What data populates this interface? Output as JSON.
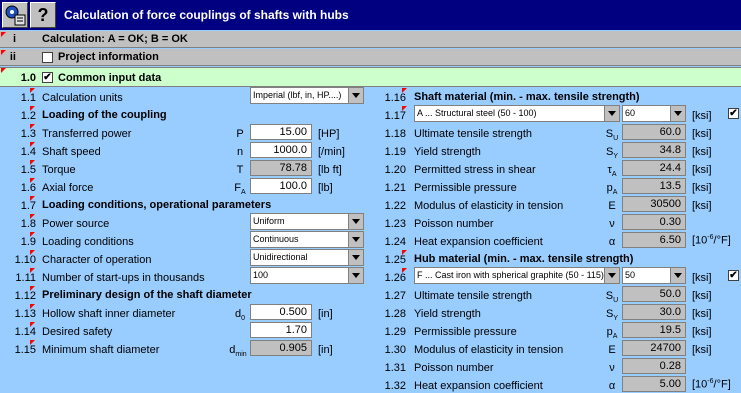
{
  "title": "Calculation of force couplings of shafts with hubs",
  "icons": {
    "app": "gear-calculator-icon",
    "help": "help-icon"
  },
  "help_label": "?",
  "band_i": {
    "num": "i",
    "text": "Calculation:  A = OK;  B = OK"
  },
  "band_ii": {
    "num": "ii",
    "text": "Project information",
    "checked": false
  },
  "band_1": {
    "num": "1.0",
    "text": "Common input data",
    "checked": true,
    "check_mark": "✔"
  },
  "left": {
    "r1_1": {
      "num": "1.1",
      "label": "Calculation units",
      "select": "Imperial (lbf, in, HP....)"
    },
    "r1_2": {
      "num": "1.2",
      "label": "Loading of the coupling"
    },
    "r1_3": {
      "num": "1.3",
      "label": "Transferred power",
      "sym": "P",
      "value": "15.00",
      "unit": "[HP]"
    },
    "r1_4": {
      "num": "1.4",
      "label": "Shaft speed",
      "sym": "n",
      "value": "1000.0",
      "unit": "[/min]"
    },
    "r1_5": {
      "num": "1.5",
      "label": "Torque",
      "sym": "T",
      "value": "78.78",
      "unit": "[lb ft]"
    },
    "r1_6": {
      "num": "1.6",
      "label": "Axial force",
      "sym": "F",
      "sym_sub": "A",
      "value": "100.0",
      "unit": "[lb]"
    },
    "r1_7": {
      "num": "1.7",
      "label": "Loading conditions, operational parameters"
    },
    "r1_8": {
      "num": "1.8",
      "label": "Power source",
      "select": "Uniform"
    },
    "r1_9": {
      "num": "1.9",
      "label": "Loading conditions",
      "select": "Continuous"
    },
    "r1_10": {
      "num": "1.10",
      "label": "Character of operation",
      "select": "Unidirectional"
    },
    "r1_11": {
      "num": "1.11",
      "label": "Number of start-ups in thousands",
      "select": "100"
    },
    "r1_12": {
      "num": "1.12",
      "label": "Preliminary design of the shaft diameter"
    },
    "r1_13": {
      "num": "1.13",
      "label": "Hollow shaft inner diameter",
      "sym": "d",
      "sym_sub": "0",
      "value": "0.500",
      "unit": "[in]"
    },
    "r1_14": {
      "num": "1.14",
      "label": "Desired safety",
      "value": "1.70"
    },
    "r1_15": {
      "num": "1.15",
      "label": "Minimum shaft diameter",
      "sym": "d",
      "sym_sub": "min",
      "value": "0.905",
      "unit": "[in]"
    }
  },
  "right": {
    "r1_16": {
      "num": "1.16",
      "label": "Shaft material (min. - max. tensile strength)"
    },
    "r1_17": {
      "num": "1.17",
      "select": "A ... Structural steel  (50 - 100)",
      "select2": "60",
      "unit": "[ksi]",
      "checked": true
    },
    "r1_18": {
      "num": "1.18",
      "label": "Ultimate tensile strength",
      "sym": "S",
      "sym_sub": "U",
      "value": "60.0",
      "unit": "[ksi]"
    },
    "r1_19": {
      "num": "1.19",
      "label": "Yield strength",
      "sym": "S",
      "sym_sub": "Y",
      "value": "34.8",
      "unit": "[ksi]"
    },
    "r1_20": {
      "num": "1.20",
      "label": "Permitted stress in shear",
      "sym": "τ",
      "sym_sub": "A",
      "value": "24.4",
      "unit": "[ksi]"
    },
    "r1_21": {
      "num": "1.21",
      "label": "Permissible pressure",
      "sym": "p",
      "sym_sub": "A",
      "value": "13.5",
      "unit": "[ksi]"
    },
    "r1_22": {
      "num": "1.22",
      "label": "Modulus of elasticity in tension",
      "sym": "E",
      "value": "30500",
      "unit": "[ksi]"
    },
    "r1_23": {
      "num": "1.23",
      "label": "Poisson number",
      "sym": "ν",
      "value": "0.30"
    },
    "r1_24": {
      "num": "1.24",
      "label": "Heat expansion coefficient",
      "sym": "α",
      "value": "6.50",
      "unit_pre": "[10",
      "unit_sup": "-6",
      "unit_post": "/°F]"
    },
    "r1_25": {
      "num": "1.25",
      "label": "Hub material (min. - max. tensile strength)"
    },
    "r1_26": {
      "num": "1.26",
      "select": "F ... Cast iron with spherical graphite  (50 - 115)",
      "select2": "50",
      "unit": "[ksi]",
      "checked": true
    },
    "r1_27": {
      "num": "1.27",
      "label": "Ultimate tensile strength",
      "sym": "S",
      "sym_sub": "U",
      "value": "50.0",
      "unit": "[ksi]"
    },
    "r1_28": {
      "num": "1.28",
      "label": "Yield strength",
      "sym": "S",
      "sym_sub": "Y",
      "value": "30.0",
      "unit": "[ksi]"
    },
    "r1_29": {
      "num": "1.29",
      "label": "Permissible pressure",
      "sym": "p",
      "sym_sub": "A",
      "value": "19.5",
      "unit": "[ksi]"
    },
    "r1_30": {
      "num": "1.30",
      "label": "Modulus of elasticity in tension",
      "sym": "E",
      "value": "24700",
      "unit": "[ksi]"
    },
    "r1_31": {
      "num": "1.31",
      "label": "Poisson number",
      "sym": "ν",
      "value": "0.28"
    },
    "r1_32": {
      "num": "1.32",
      "label": "Heat expansion coefficient",
      "sym": "α",
      "value": "5.00",
      "unit_pre": "[10",
      "unit_sup": "-6",
      "unit_post": "/°F]"
    }
  }
}
